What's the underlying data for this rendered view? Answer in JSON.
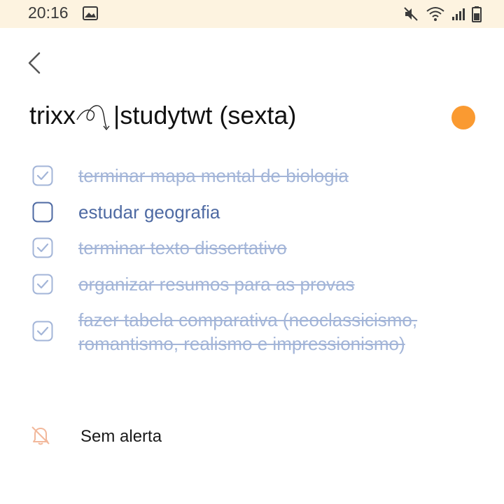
{
  "status_bar": {
    "time": "20:16",
    "icons": [
      "gallery-icon",
      "mute-icon",
      "wifi-icon",
      "signal-icon",
      "battery-icon"
    ]
  },
  "header": {
    "back_icon": "chevron-left-icon"
  },
  "note": {
    "title_prefix": "trixx",
    "title_suffix": "|studytwt (sexta)",
    "color": "#fa9a31"
  },
  "checklist": {
    "items": [
      {
        "text": "terminar mapa mental de biologia",
        "checked": true
      },
      {
        "text": "estudar geografia",
        "checked": false
      },
      {
        "text": "terminar texto dissertativo",
        "checked": true
      },
      {
        "text": "organizar resumos para as provas",
        "checked": true
      },
      {
        "text": "fazer tabela comparativa (neoclassicismo, romantismo, realismo e impressionismo)",
        "checked": true
      }
    ]
  },
  "alert": {
    "icon": "bell-off-icon",
    "label": "Sem alerta"
  },
  "colors": {
    "status_bar_bg": "#fdf3e0",
    "checked_text": "#a3b5d8",
    "unchecked_text": "#4e6aa3",
    "accent_orange": "#fa9a31"
  }
}
